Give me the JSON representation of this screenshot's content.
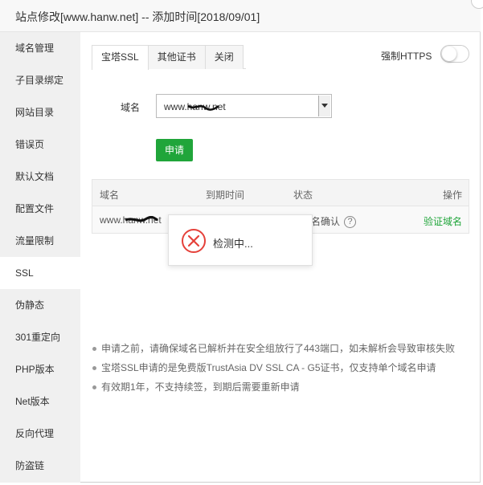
{
  "window": {
    "title": "站点修改[www.hanw.net] -- 添加时间[2018/09/01]"
  },
  "sidebar": {
    "items": [
      {
        "label": "域名管理"
      },
      {
        "label": "子目录绑定"
      },
      {
        "label": "网站目录"
      },
      {
        "label": "错误页"
      },
      {
        "label": "默认文档"
      },
      {
        "label": "配置文件"
      },
      {
        "label": "流量限制"
      },
      {
        "label": "SSL",
        "active": true
      },
      {
        "label": "伪静态"
      },
      {
        "label": "301重定向"
      },
      {
        "label": "PHP版本"
      },
      {
        "label": "Net版本"
      },
      {
        "label": "反向代理"
      },
      {
        "label": "防盗链"
      }
    ]
  },
  "ssl": {
    "tabs": [
      {
        "label": "宝塔SSL",
        "active": true
      },
      {
        "label": "其他证书"
      },
      {
        "label": "关闭"
      }
    ],
    "force_https_label": "强制HTTPS",
    "force_https_on": false,
    "domain_label": "域名",
    "domain_selected": "www.hanw.net",
    "apply_button": "申请",
    "table": {
      "headers": [
        "域名",
        "到期时间",
        "状态",
        "操作"
      ],
      "rows": [
        {
          "domain": "www.hanw.net",
          "status": "名确认",
          "action": "验证域名"
        }
      ]
    },
    "popup": {
      "message": "检测中..."
    },
    "notes": [
      "申请之前，请确保域名已解析并在安全组放行了443端口，如未解析会导致审核失败",
      "宝塔SSL申请的是免费版TrustAsia DV SSL CA - G5证书，仅支持单个域名申请",
      "有效期1年，不支持续签，到期后需要重新申请"
    ]
  },
  "colors": {
    "accent": "#20a53a",
    "error": "#e5413a",
    "sidebar_bg": "#f0f0f0"
  }
}
